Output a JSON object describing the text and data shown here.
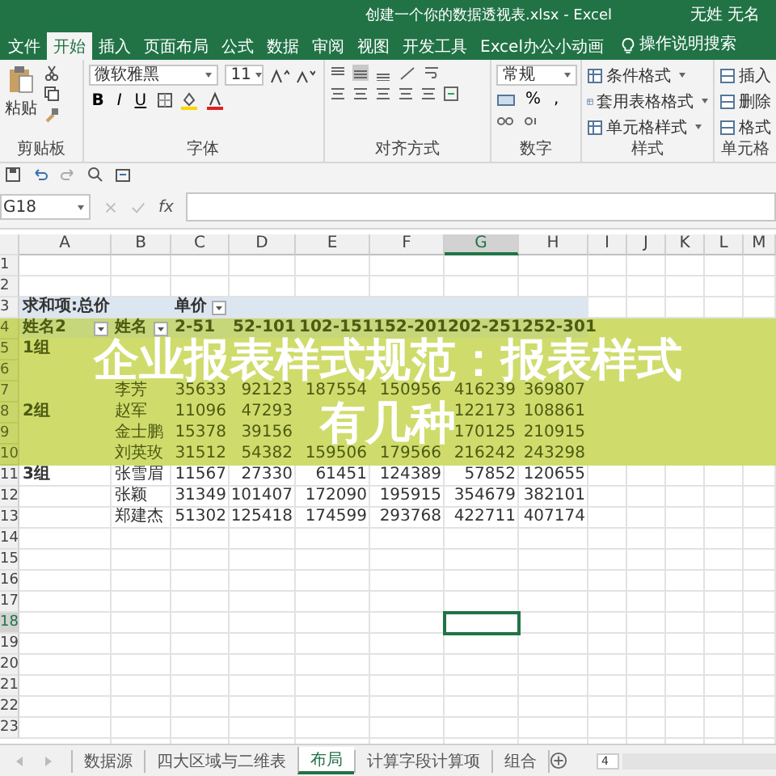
{
  "window": {
    "title": "创建一个你的数据透视表.xlsx  -  Excel",
    "user": "无姓 无名"
  },
  "ribbon_tabs": [
    {
      "label": "文件",
      "selected": false
    },
    {
      "label": "开始",
      "selected": true
    },
    {
      "label": "插入",
      "selected": false
    },
    {
      "label": "页面布局",
      "selected": false
    },
    {
      "label": "公式",
      "selected": false
    },
    {
      "label": "数据",
      "selected": false
    },
    {
      "label": "审阅",
      "selected": false
    },
    {
      "label": "视图",
      "selected": false
    },
    {
      "label": "开发工具",
      "selected": false
    },
    {
      "label": "Excel办公小动画",
      "selected": false
    }
  ],
  "tell_me": "操作说明搜索",
  "ribbon": {
    "clipboard": {
      "paste": "粘贴",
      "label": "剪贴板"
    },
    "font": {
      "name": "微软雅黑",
      "size": "11",
      "format_buttons": [
        "B",
        "I",
        "U"
      ],
      "label": "字体"
    },
    "alignment": {
      "label": "对齐方式"
    },
    "number": {
      "format": "常规",
      "percent": "%",
      "comma": ",",
      "label": "数字"
    },
    "styles": {
      "items": [
        "条件格式",
        "套用表格格式",
        "单元格样式"
      ],
      "label": "样式"
    },
    "cells": {
      "items": [
        "插入",
        "删除",
        "格式"
      ],
      "label": "单元格"
    }
  },
  "name_box": "G18",
  "function_label": "fx",
  "columns": [
    {
      "label": "A",
      "selected": false
    },
    {
      "label": "B",
      "selected": false
    },
    {
      "label": "C",
      "selected": false
    },
    {
      "label": "D",
      "selected": false
    },
    {
      "label": "E",
      "selected": false
    },
    {
      "label": "F",
      "selected": false
    },
    {
      "label": "G",
      "selected": true
    },
    {
      "label": "H",
      "selected": false
    },
    {
      "label": "I",
      "selected": false
    },
    {
      "label": "J",
      "selected": false
    },
    {
      "label": "K",
      "selected": false
    },
    {
      "label": "L",
      "selected": false
    },
    {
      "label": "M",
      "selected": false
    }
  ],
  "rows": [
    {
      "number": "1",
      "selected": false,
      "kind": "data",
      "cells": {}
    },
    {
      "number": "2",
      "selected": false,
      "kind": "data",
      "cells": {}
    },
    {
      "number": "3",
      "selected": false,
      "kind": "pivot-header",
      "cells": {
        "A": {
          "text": "求和项:总价"
        },
        "C": {
          "text": "单价",
          "filter": true
        }
      }
    },
    {
      "number": "4",
      "selected": false,
      "kind": "pivot-header",
      "cells": {
        "A": {
          "text": "姓名2",
          "filter": true
        },
        "B": {
          "text": "姓名",
          "filter": true
        },
        "C": {
          "text": "2-51"
        },
        "D": {
          "text": "52-101"
        },
        "E": {
          "text": "102-151"
        },
        "F": {
          "text": "152-201"
        },
        "G": {
          "text": "202-251"
        },
        "H": {
          "text": "252-301"
        }
      }
    },
    {
      "number": "5",
      "selected": false,
      "kind": "data",
      "cells": {
        "A": {
          "text": "1组"
        }
      }
    },
    {
      "number": "6",
      "selected": false,
      "kind": "data",
      "cells": {}
    },
    {
      "number": "7",
      "selected": false,
      "kind": "data",
      "cells": {
        "B": {
          "text": "李芳"
        },
        "C": {
          "text": "35633"
        },
        "D": {
          "text": "92123"
        },
        "E": {
          "text": "187554"
        },
        "F": {
          "text": "150956"
        },
        "G": {
          "text": "416239"
        },
        "H": {
          "text": "369807"
        }
      }
    },
    {
      "number": "8",
      "selected": false,
      "kind": "data",
      "cells": {
        "A": {
          "text": "2组"
        },
        "B": {
          "text": "赵军"
        },
        "C": {
          "text": "11096"
        },
        "D": {
          "text": "47293"
        },
        "G": {
          "text": "122173"
        },
        "H": {
          "text": "108861"
        }
      }
    },
    {
      "number": "9",
      "selected": false,
      "kind": "data",
      "cells": {
        "B": {
          "text": "金士鹏"
        },
        "C": {
          "text": "15378"
        },
        "D": {
          "text": "39156"
        },
        "G": {
          "text": "170125"
        },
        "H": {
          "text": "210915"
        }
      }
    },
    {
      "number": "10",
      "selected": false,
      "kind": "data",
      "cells": {
        "B": {
          "text": "刘英玫"
        },
        "C": {
          "text": "31512"
        },
        "D": {
          "text": "54382"
        },
        "E": {
          "text": "159506"
        },
        "F": {
          "text": "179566"
        },
        "G": {
          "text": "216242"
        },
        "H": {
          "text": "243298"
        }
      }
    },
    {
      "number": "11",
      "selected": false,
      "kind": "data",
      "cells": {
        "A": {
          "text": "3组"
        },
        "B": {
          "text": "张雪眉"
        },
        "C": {
          "text": "11567"
        },
        "D": {
          "text": "27330"
        },
        "E": {
          "text": "61451"
        },
        "F": {
          "text": "124389"
        },
        "G": {
          "text": "57852"
        },
        "H": {
          "text": "120655"
        }
      }
    },
    {
      "number": "12",
      "selected": false,
      "kind": "data",
      "cells": {
        "B": {
          "text": "张颖"
        },
        "C": {
          "text": "31349"
        },
        "D": {
          "text": "101407"
        },
        "E": {
          "text": "172090"
        },
        "F": {
          "text": "195915"
        },
        "G": {
          "text": "354679"
        },
        "H": {
          "text": "382101"
        }
      }
    },
    {
      "number": "13",
      "selected": false,
      "kind": "data",
      "cells": {
        "B": {
          "text": "郑建杰"
        },
        "C": {
          "text": "51302"
        },
        "D": {
          "text": "125418"
        },
        "E": {
          "text": "174599"
        },
        "F": {
          "text": "293768"
        },
        "G": {
          "text": "422711"
        },
        "H": {
          "text": "407174"
        }
      }
    },
    {
      "number": "14",
      "selected": false,
      "kind": "data",
      "cells": {}
    },
    {
      "number": "15",
      "selected": false,
      "kind": "data",
      "cells": {}
    },
    {
      "number": "16",
      "selected": false,
      "kind": "data",
      "cells": {}
    },
    {
      "number": "17",
      "selected": false,
      "kind": "data",
      "cells": {}
    },
    {
      "number": "18",
      "selected": true,
      "kind": "data",
      "cells": {}
    },
    {
      "number": "19",
      "selected": false,
      "kind": "data",
      "cells": {}
    },
    {
      "number": "20",
      "selected": false,
      "kind": "data",
      "cells": {}
    },
    {
      "number": "21",
      "selected": false,
      "kind": "data",
      "cells": {}
    },
    {
      "number": "22",
      "selected": false,
      "kind": "data",
      "cells": {}
    },
    {
      "number": "23",
      "selected": false,
      "kind": "data",
      "cells": {}
    }
  ],
  "banner": {
    "lines": [
      "企业报表样式规范：报表样式",
      "有几种"
    ]
  },
  "sheet_tabs": [
    {
      "label": "数据源",
      "selected": false
    },
    {
      "label": "四大区域与二维表",
      "selected": false
    },
    {
      "label": "布局",
      "selected": true
    },
    {
      "label": "计算字段计算项",
      "selected": false
    },
    {
      "label": "组合",
      "selected": false
    }
  ],
  "page_box": "4"
}
